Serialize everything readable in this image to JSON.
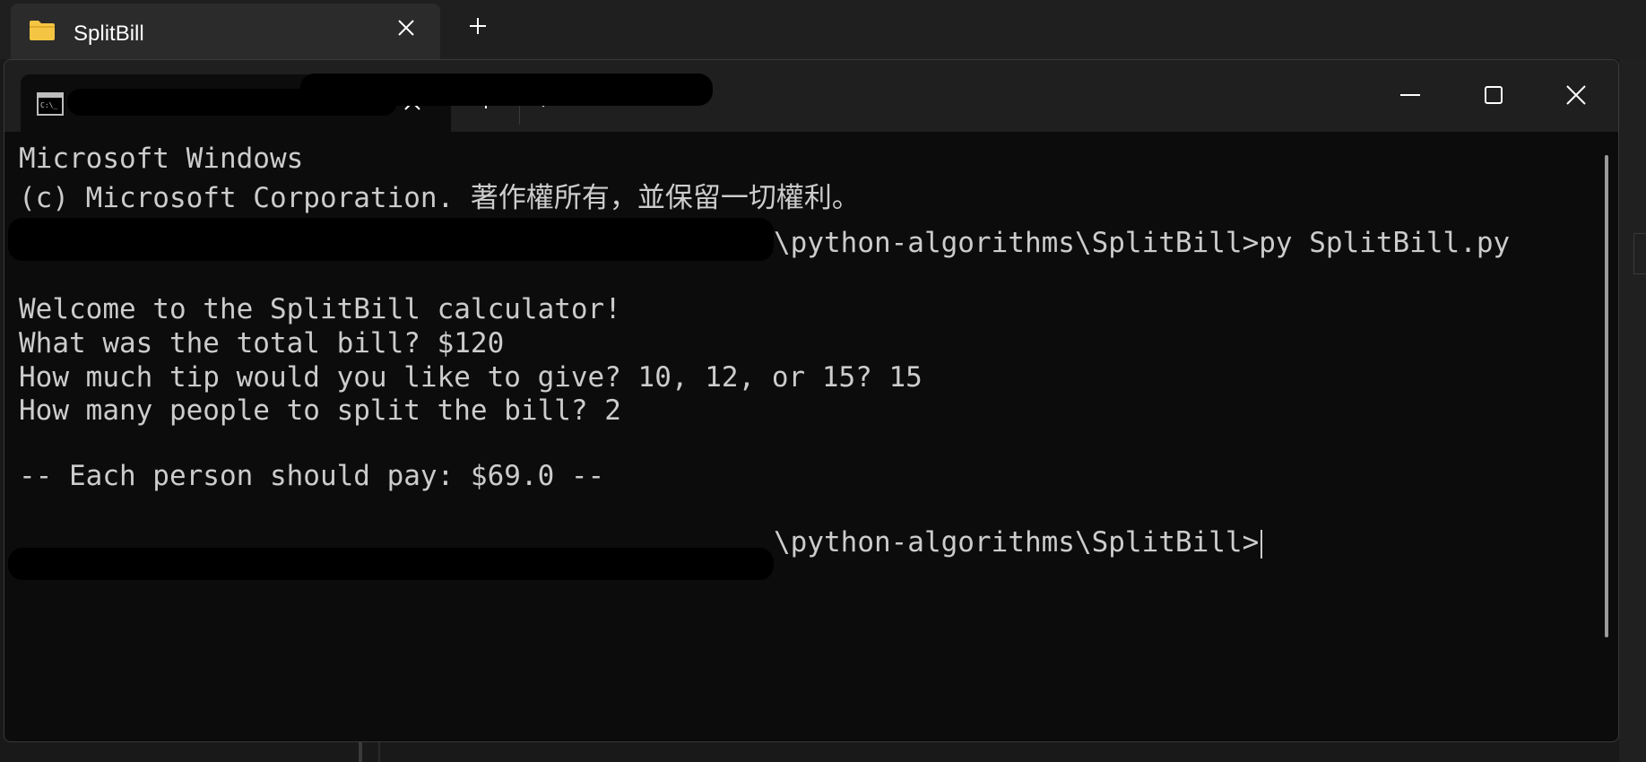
{
  "explorer": {
    "tab_title": "SplitBill",
    "folder_color": "#f4c542"
  },
  "terminal": {
    "tab_icon": "cmd-icon",
    "console": {
      "header_line1": "Microsoft Windows",
      "header_line2": "(c) Microsoft Corporation. 著作權所有，並保留一切權利。",
      "prompt1_path": "\\python-algorithms\\SplitBill>",
      "prompt1_command": "py SplitBill.py",
      "output": [
        "Welcome to the SplitBill calculator!",
        "What was the total bill? $120",
        "How much tip would you like to give? 10, 12, or 15? 15",
        "How many people to split the bill? 2"
      ],
      "result": "-- Each person should pay: $69.0 --",
      "prompt2_path": "\\python-algorithms\\SplitBill>"
    }
  },
  "colors": {
    "terminal_bg": "#0c0c0c",
    "titlebar_bg": "#1f1f1f",
    "text": "#cccccc"
  }
}
